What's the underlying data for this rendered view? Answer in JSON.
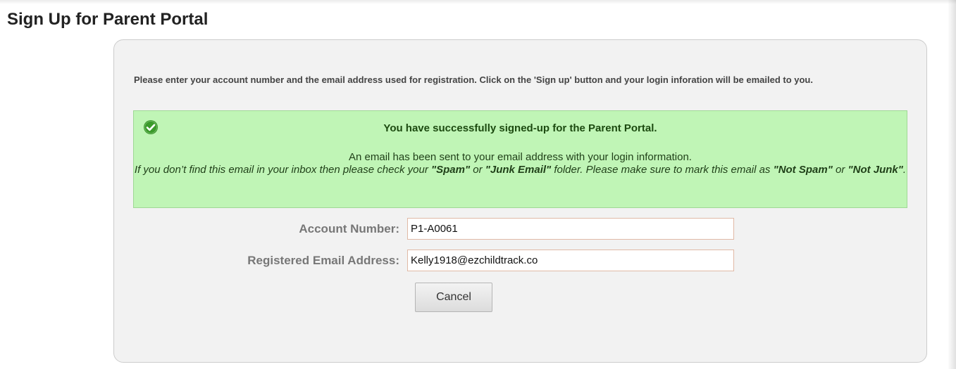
{
  "page": {
    "title": "Sign Up for Parent Portal"
  },
  "instructions": {
    "text": "Please enter your account number and the email address used for registration. Click on the 'Sign up' button and your login inforation will be emailed to you."
  },
  "success": {
    "icon": "check-circle-icon",
    "title": "You have successfully signed-up for the Parent Portal.",
    "line1": "An email has been sent to your email address with your login information.",
    "line2_prefix": "If you don’t find this email in your inbox then please check your ",
    "spam_label": "\"Spam\"",
    "or1": " or ",
    "junk_email_label": "\"Junk Email\"",
    "line2_mid": " folder. Please make sure to mark this email as ",
    "not_spam_label": "\"Not Spam\"",
    "or2": " or ",
    "not_junk_label": "\"Not Junk\"",
    "period": "."
  },
  "form": {
    "account_number_label": "Account Number:",
    "account_number_value": "P1-A0061",
    "email_label": "Registered Email Address:",
    "email_value": "Kelly1918@ezchildtrack.co",
    "cancel_label": "Cancel"
  },
  "colors": {
    "success_background": "#c0f5b6",
    "success_border": "#9fd895",
    "success_icon": "#3a9a2a",
    "panel_background": "#f2f2f2",
    "input_border": "#e0b9a6"
  }
}
